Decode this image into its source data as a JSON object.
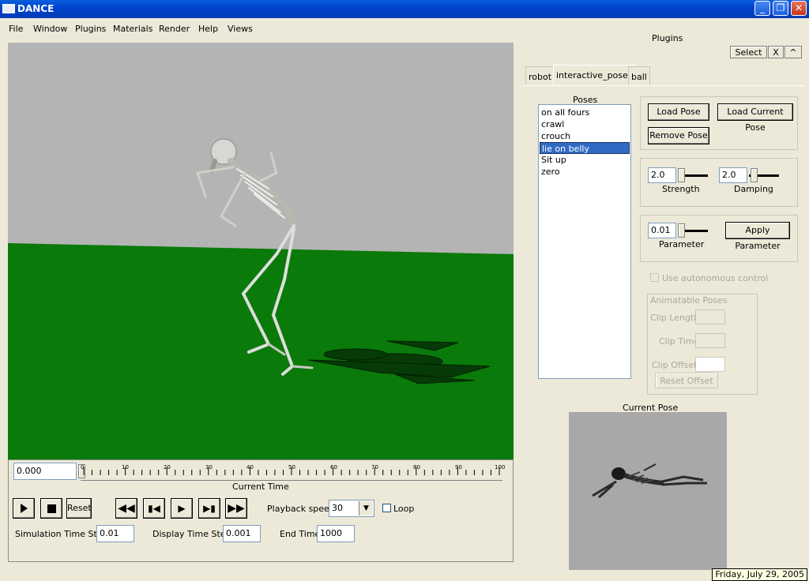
{
  "window": {
    "title": "DANCE"
  },
  "menu": [
    "File",
    "Window",
    "Plugins",
    "Materials",
    "Render",
    "Help",
    "Views"
  ],
  "time_panel": {
    "current_time_value": "0.000",
    "current_time_label": "Current Time",
    "tick_labels": [
      "0",
      "10",
      "20",
      "30",
      "40",
      "50",
      "60",
      "70",
      "80",
      "90",
      "100"
    ],
    "reset_label": "Reset",
    "playback_speed_label": "Playback speed",
    "playback_speed_value": "30",
    "loop_label": "Loop",
    "sim_step_label": "Simulation Time Step",
    "sim_step_value": "0.01",
    "display_step_label": "Display Time Step",
    "display_step_value": "0.001",
    "end_time_label": "End Time",
    "end_time_value": "1000"
  },
  "plugins_panel": {
    "title": "Plugins",
    "select_label": "Select",
    "x_label": "X",
    "caret_label": "^",
    "tabs": [
      "robot",
      "interactive_poses",
      "ball"
    ]
  },
  "poses": {
    "header": "Poses",
    "items": [
      "on all fours",
      "crawl",
      "crouch",
      "lie on belly",
      "Sit up",
      "zero"
    ],
    "selected_index": 3,
    "load_pose": "Load Pose",
    "load_current_pose": "Load Current Pose",
    "remove_pose": "Remove Pose",
    "strength_value": "2.0",
    "strength_label": "Strength",
    "damping_value": "2.0",
    "damping_label": "Damping",
    "parameter_value": "0.01",
    "parameter_label": "Parameter",
    "apply_parameter": "Apply Parameter",
    "autonomous_label": "Use autonomous control",
    "animatable_label": "Animatable Poses",
    "clip_length_label": "Clip Length",
    "clip_time_label": "Clip Time",
    "clip_offset_label": "Clip Offset",
    "reset_offset_label": "Reset Offset",
    "current_pose_label": "Current Pose"
  },
  "status": {
    "date": "Friday, July 29, 2005"
  },
  "colors": {
    "sky": "#b4b4b4",
    "ground": "#0a7a0a",
    "selection": "#316ac5",
    "titlebar": "#0a5fe0"
  }
}
